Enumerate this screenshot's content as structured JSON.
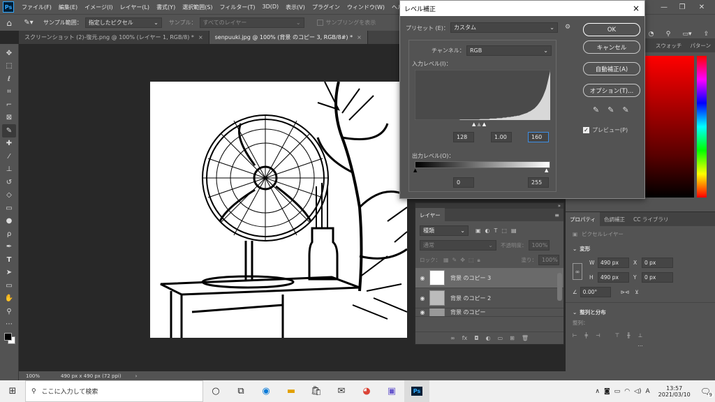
{
  "menubar": {
    "app_icon": "Ps",
    "items": [
      "ファイル(F)",
      "編集(E)",
      "イメージ(I)",
      "レイヤー(L)",
      "書式(Y)",
      "選択範囲(S)",
      "フィルター(T)",
      "3D(D)",
      "表示(V)",
      "プラグイン",
      "ウィンドウ(W)",
      "ヘルプ(H)"
    ]
  },
  "options_bar": {
    "sample_size_label": "サンプル範囲：",
    "sample_size_value": "指定したピクセル",
    "sample_label": "サンプル：",
    "sample_value": "すべてのレイヤー",
    "show_ring_label": "サンプリングを表示"
  },
  "document_tabs": [
    {
      "label": "スクリーンショット (2)-復元.png @ 100% (レイヤー 1, RGB/8) *",
      "close": "×"
    },
    {
      "label": "senpuuki.jpg @ 100% (背景 のコピー 3, RGB/8#) *",
      "close": "×"
    }
  ],
  "status_bar": {
    "zoom": "100%",
    "doc_info": "490 px x 490 px (72 ppi)",
    "arrow": "›"
  },
  "levels_dialog": {
    "title": "レベル補正",
    "close": "×",
    "preset_label": "プリセット (E)：",
    "preset_value": "カスタム",
    "channel_label": "チャンネル：",
    "channel_value": "RGB",
    "input_levels_label": "入力レベル(I)：",
    "input_black": "128",
    "input_gamma": "1.00",
    "input_white": "160",
    "output_levels_label": "出力レベル(O)：",
    "output_black": "0",
    "output_white": "255",
    "ok_label": "OK",
    "cancel_label": "キャンセル",
    "auto_label": "自動補正(A)",
    "options_label": "オプション(T)...",
    "preview_label": "プレビュー(P)",
    "preview_checked": true
  },
  "color_panel": {
    "tabs": [
      "スウォッチ",
      "パターン"
    ]
  },
  "layers_panel": {
    "tab": "レイヤー",
    "filter_placeholder": "種類",
    "blend_mode": "通常",
    "opacity_label": "不透明度：",
    "opacity_value": "100%",
    "lock_label": "ロック：",
    "fill_label": "塗り：",
    "fill_value": "100%",
    "layers": [
      {
        "name": "背景 のコピー 3",
        "selected": true
      },
      {
        "name": "背景 のコピー 2",
        "selected": false
      },
      {
        "name": "背景 のコピー",
        "selected": false
      }
    ]
  },
  "properties_panel": {
    "tabs": [
      "プロパティ",
      "色調補正",
      "CC ライブラリ"
    ],
    "layer_kind": "ピクセルレイヤー",
    "transform_label": "変形",
    "w_label": "W",
    "w_value": "490 px",
    "h_label": "H",
    "h_value": "490 px",
    "x_label": "X",
    "x_value": "0 px",
    "y_label": "Y",
    "y_value": "0 px",
    "angle_value": "0.00°",
    "align_label": "整列と分布",
    "align_sub": "整列："
  },
  "taskbar": {
    "search_placeholder": "ここに入力して検索",
    "time": "13:57",
    "date": "2021/03/10",
    "ime": "A",
    "notification_count": "9"
  },
  "histogram": [
    0,
    0,
    0,
    0,
    0,
    0,
    0,
    0,
    0,
    0,
    0,
    0,
    0,
    0,
    0,
    0,
    0,
    0,
    0,
    0,
    0,
    0,
    0,
    0,
    0,
    0,
    0,
    0,
    0,
    0,
    0,
    0,
    1,
    1,
    1,
    1,
    1,
    1,
    1,
    1,
    1,
    1,
    1,
    1,
    1,
    1,
    2,
    2,
    2,
    2,
    2,
    2,
    2,
    3,
    3,
    3,
    3,
    3,
    4,
    4,
    4,
    4,
    5,
    5,
    5,
    6,
    6,
    6,
    7,
    7,
    8,
    8,
    9,
    9,
    10,
    11,
    12,
    13,
    14,
    15,
    17,
    18,
    20,
    22,
    24,
    27,
    30,
    34,
    38,
    43,
    49,
    56,
    64,
    75,
    88,
    100
  ]
}
